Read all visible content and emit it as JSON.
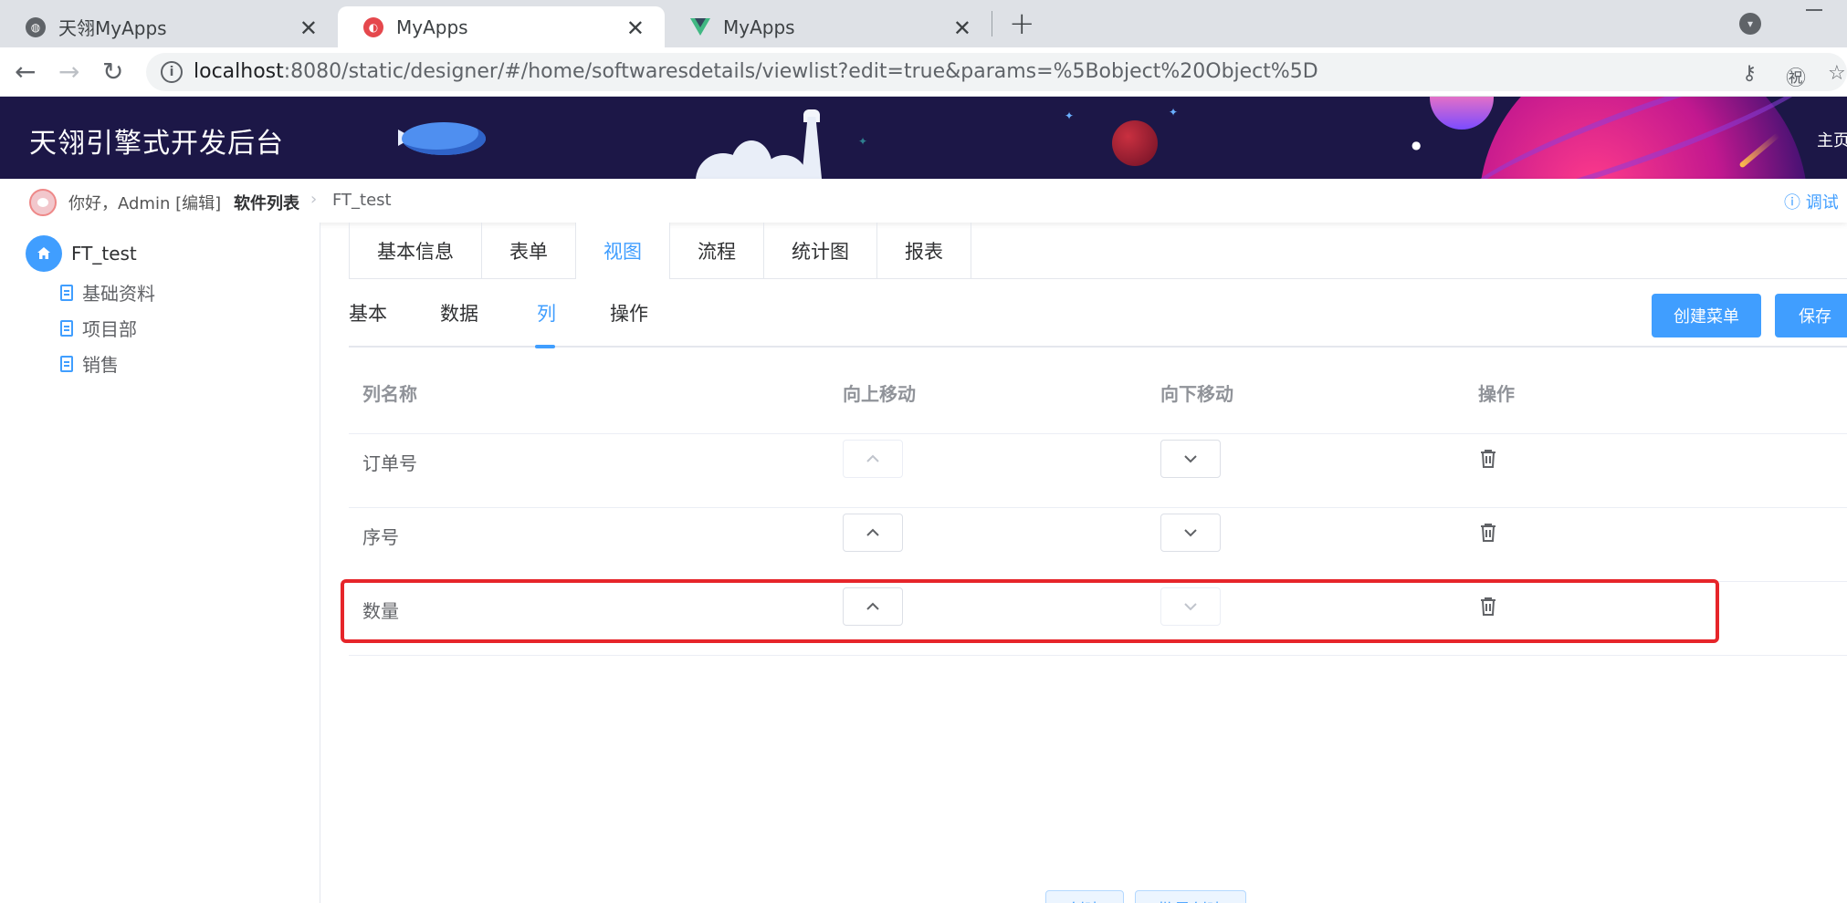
{
  "browser": {
    "tabs": [
      {
        "title": "天翎MyApps",
        "active": false
      },
      {
        "title": "MyApps",
        "active": true
      },
      {
        "title": "MyApps",
        "active": false
      }
    ],
    "close_glyph": "✕",
    "new_tab_glyph": "+",
    "url_host": "localhost",
    "url_rest": ":8080/static/designer/#/home/softwaresdetails/viewlist?edit=true&params=%5Bobject%20Object%5D",
    "back_glyph": "←",
    "forward_glyph": "→",
    "reload_glyph": "↻"
  },
  "header": {
    "title": "天翎引擎式开发后台",
    "home_link": "主页"
  },
  "subbar": {
    "greeting": "你好，Admin [编辑]",
    "breadcrumb": [
      "软件列表",
      "FT_test"
    ],
    "debug": "ⓘ 调试"
  },
  "sidebar": {
    "root": "FT_test",
    "items": [
      {
        "label": "基础资料"
      },
      {
        "label": "项目部"
      },
      {
        "label": "销售"
      }
    ]
  },
  "main": {
    "card_tabs": [
      {
        "label": "基本信息"
      },
      {
        "label": "表单"
      },
      {
        "label": "视图",
        "active": true
      },
      {
        "label": "流程"
      },
      {
        "label": "统计图"
      },
      {
        "label": "报表"
      }
    ],
    "sub_tabs": [
      {
        "label": "基本"
      },
      {
        "label": "数据"
      },
      {
        "label": "列",
        "active": true
      },
      {
        "label": "操作"
      }
    ],
    "actions": {
      "create_menu": "创建菜单",
      "save": "保存"
    },
    "table": {
      "headers": [
        "列名称",
        "向上移动",
        "向下移动",
        "操作"
      ],
      "rows": [
        {
          "name": "订单号",
          "up_enabled": false,
          "down_enabled": true
        },
        {
          "name": "序号",
          "up_enabled": true,
          "down_enabled": true
        },
        {
          "name": "数量",
          "up_enabled": true,
          "down_enabled": false,
          "highlighted": true
        }
      ]
    },
    "bottom": {
      "create": "创建",
      "batch_create": "批量创建"
    }
  },
  "colors": {
    "primary": "#409eff",
    "header_bg": "#1c1747",
    "highlight": "#e6252a"
  }
}
